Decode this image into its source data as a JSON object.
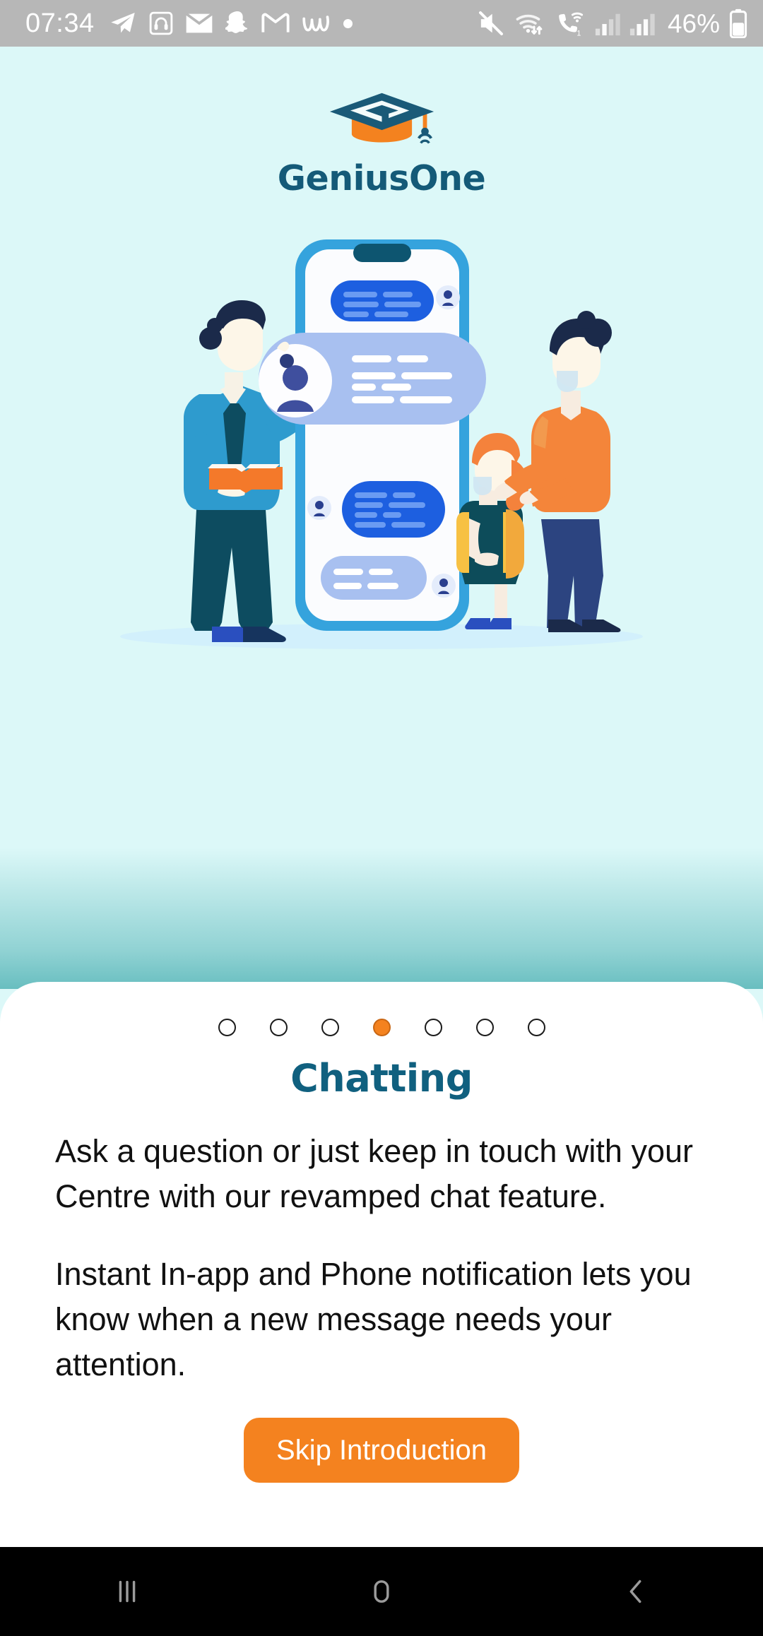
{
  "status_bar": {
    "time": "07:34",
    "battery_percent": "46%",
    "left_icons": [
      {
        "name": "telegram-icon"
      },
      {
        "name": "headphones-app-icon"
      },
      {
        "name": "email-icon"
      },
      {
        "name": "snapchat-icon"
      },
      {
        "name": "gmail-icon"
      },
      {
        "name": "wattpad-icon"
      },
      {
        "name": "more-notifications-dot-icon"
      }
    ],
    "right_icons": [
      {
        "name": "mute-icon"
      },
      {
        "name": "wifi-data-transfer-icon"
      },
      {
        "name": "wifi-calling-icon"
      },
      {
        "name": "signal-sim1-icon"
      },
      {
        "name": "signal-sim2-icon"
      },
      {
        "name": "battery-icon"
      }
    ]
  },
  "brand": {
    "name": "GeniusOne",
    "logo_icon": "graduation-cap-logo-icon",
    "cap_color": "#1a5a78",
    "base_color": "#f4821f",
    "text_color": "#145a78"
  },
  "illustration": {
    "name": "chatting-illustration",
    "alt": "Teacher with book, large phone showing chat bubbles, mother and schoolgirl",
    "colors": {
      "background": "#dcf8f8",
      "phone_frame": "#35a3dd",
      "bubble_primary": "#1d5fe0",
      "bubble_secondary": "#a8c0f0",
      "teacher_shirt": "#2e9bce",
      "teacher_pants": "#0d4c60",
      "book": "#f4792a",
      "mother_top": "#f4853a",
      "mother_pants": "#2c4480",
      "girl_dress": "#0d4c5a",
      "girl_hair": "#f4823c",
      "girl_backpack": "#f7c143"
    }
  },
  "onboarding": {
    "pagination": {
      "total": 7,
      "active_index": 3,
      "active_color": "#f4821f"
    },
    "title": "Chatting",
    "paragraph_1": "Ask a question or just keep in touch with your Centre with our revamped chat feature.",
    "paragraph_2": "Instant In-app and Phone notification lets you know when a new message needs your attention.",
    "skip_button_label": "Skip Introduction",
    "skip_button_color": "#f4821f",
    "title_color": "#10607f"
  },
  "nav_bar": {
    "recents_label": "recent-apps",
    "home_label": "home",
    "back_label": "back"
  }
}
